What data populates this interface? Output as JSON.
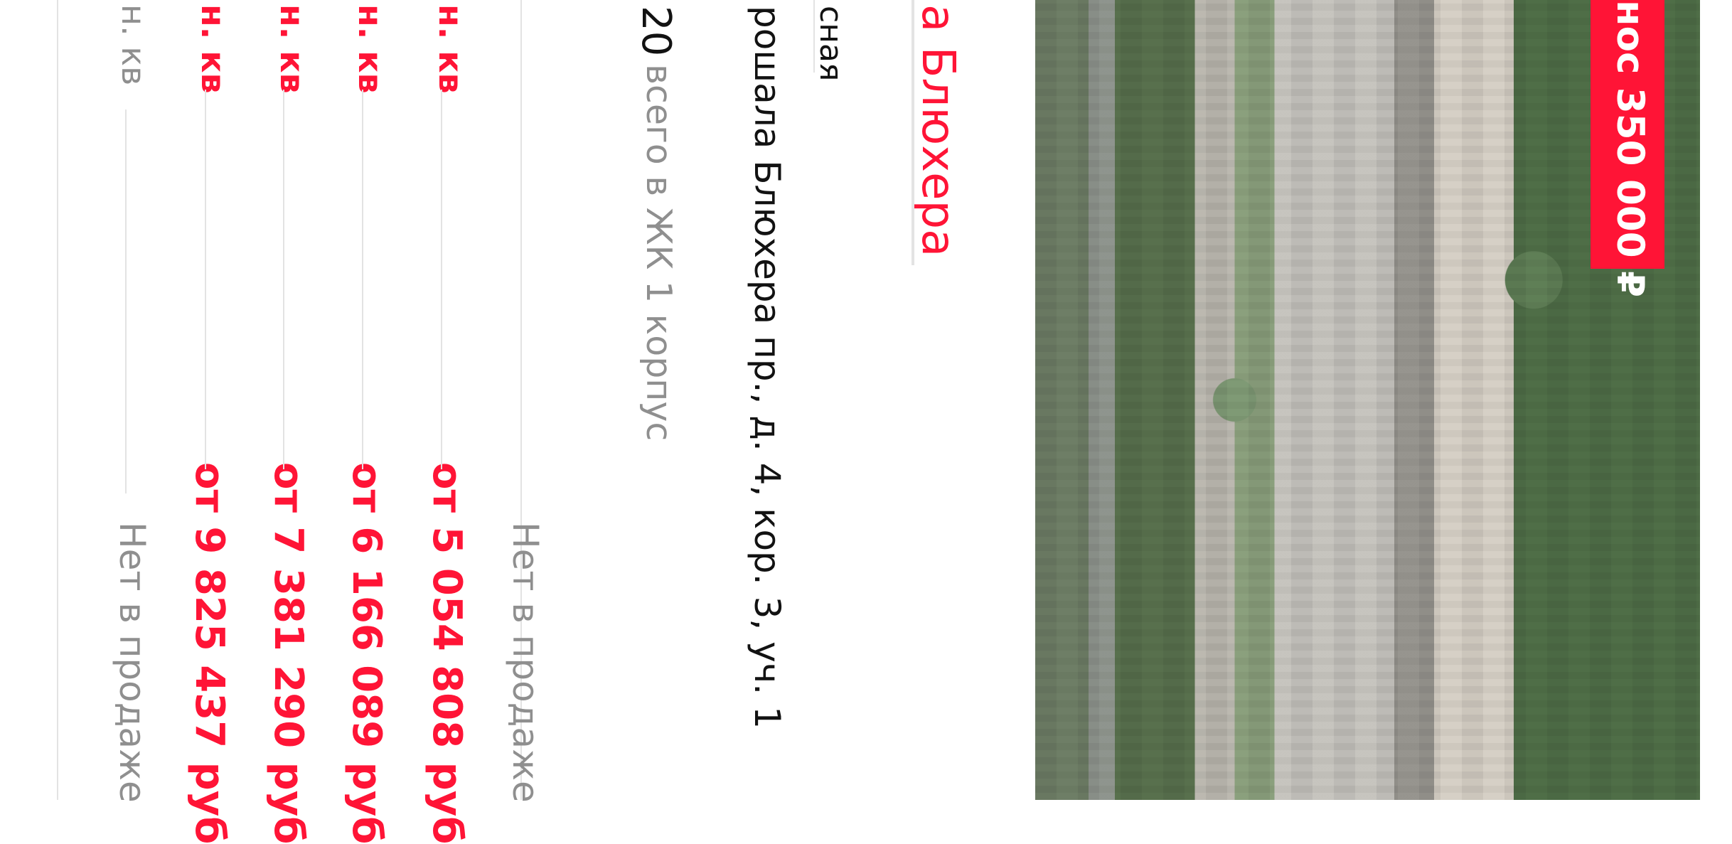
{
  "complex_title": "а Блюхера",
  "district": "сная",
  "address": "рошала Блюхера пр., д. 4, кор. 3, уч. 1",
  "completion": {
    "year": "20",
    "suffix": "всего в ЖК 1 корпус"
  },
  "promo": {
    "text": "нос 350 000 ₽"
  },
  "apartments": {
    "sold_out_label": "Нет в продаже",
    "rows": [
      {
        "label": "н. кв",
        "price": "Нет в продаже"
      },
      {
        "label": "н. кв",
        "price": "от 9 825 437 руб"
      },
      {
        "label": "н. кв",
        "price": "от 7 381 290 руб"
      },
      {
        "label": "н. кв",
        "price": "от 6 166 089 руб"
      },
      {
        "label": "н. кв",
        "price": "от 5 054 808 руб"
      }
    ]
  },
  "colors": {
    "accent": "#ff1436",
    "muted": "#8f8f8f",
    "text": "#121212"
  }
}
